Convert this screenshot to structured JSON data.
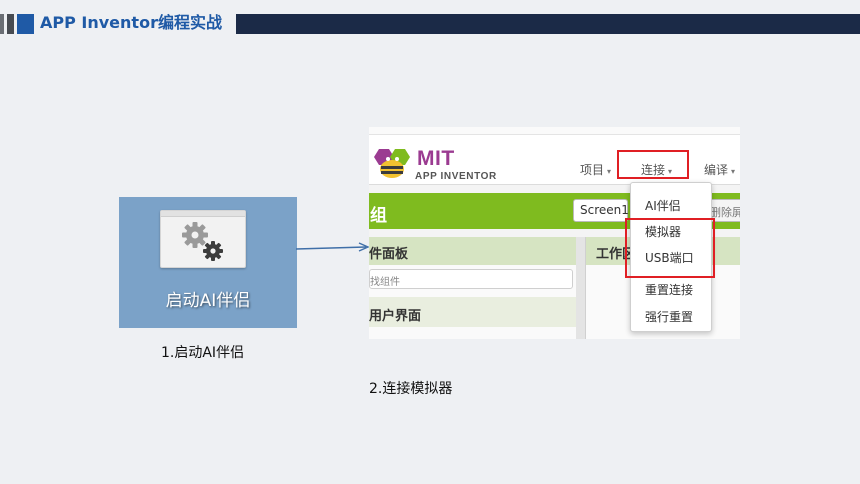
{
  "slide": {
    "title": "APP Inventor编程实战",
    "colors": {
      "accent": "#1f5aa6",
      "header_bar": "#1b2a47",
      "highlight": "#e01f24",
      "ai_green": "#7fbb1f"
    }
  },
  "step1": {
    "icon": "gears-icon",
    "label": "启动AI伴侣",
    "caption": "1.启动AI伴侣"
  },
  "step2": {
    "caption": "2.连接模拟器",
    "logo_text": "MIT",
    "logo_subtext": "APP INVENTOR",
    "menu": [
      "项目",
      "连接",
      "编译"
    ],
    "menu_caret": "▾",
    "section_label": "组",
    "screen_selector": "Screen1",
    "delete_button": "删除屏",
    "palette_title": "件面板",
    "palette_search_placeholder": "找组件",
    "palette_section": "用户界面",
    "workspace_title": "工作区",
    "connect_menu": [
      "AI伴侣",
      "模拟器",
      "USB端口",
      "重置连接",
      "强行重置"
    ]
  }
}
